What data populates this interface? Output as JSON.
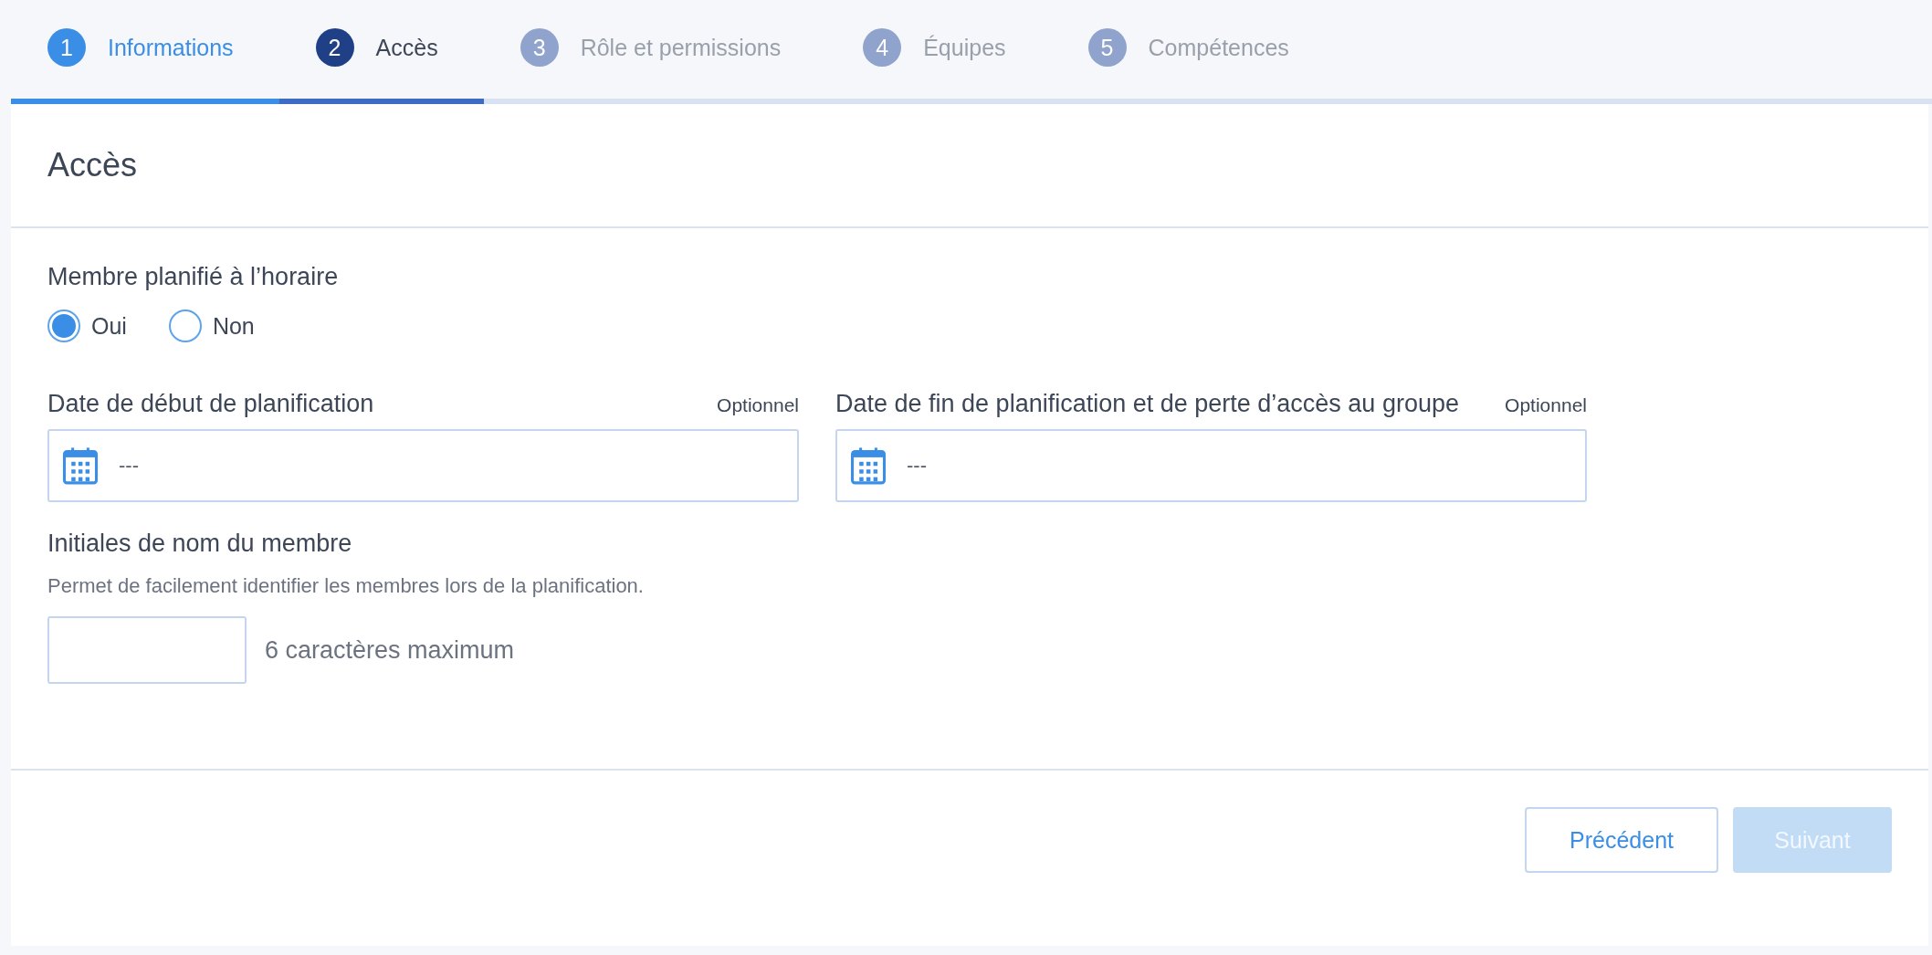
{
  "steps": [
    {
      "number": "1",
      "label": "Informations",
      "completed": true,
      "selected": false
    },
    {
      "number": "2",
      "label": "Accès",
      "completed": false,
      "selected": true
    },
    {
      "number": "3",
      "label": "Rôle et permissions",
      "completed": false,
      "selected": false
    },
    {
      "number": "4",
      "label": "Équipes",
      "completed": false,
      "selected": false
    },
    {
      "number": "5",
      "label": "Compétences",
      "completed": false,
      "selected": false
    }
  ],
  "card": {
    "title": "Accès",
    "scheduled": {
      "label": "Membre planifié à l’horaire",
      "options": [
        {
          "label": "Oui",
          "selected": true
        },
        {
          "label": "Non",
          "selected": false
        }
      ]
    },
    "date_fields": [
      {
        "label": "Date de début de planification",
        "hint": "Optionnel",
        "placeholder": "---"
      },
      {
        "label": "Date de fin de planification et de perte d’accès au groupe",
        "hint": "Optionnel",
        "placeholder": "---"
      }
    ],
    "initials": {
      "label": "Initiales de nom du membre",
      "help": "Permet de facilement identifier les membres lors de la planification.",
      "note": "6 caractères maximum"
    },
    "buttons": [
      {
        "label": "Précédent",
        "kind": "secondary",
        "disabled": false
      },
      {
        "label": "Suivant",
        "kind": "primary",
        "disabled": true
      }
    ]
  }
}
